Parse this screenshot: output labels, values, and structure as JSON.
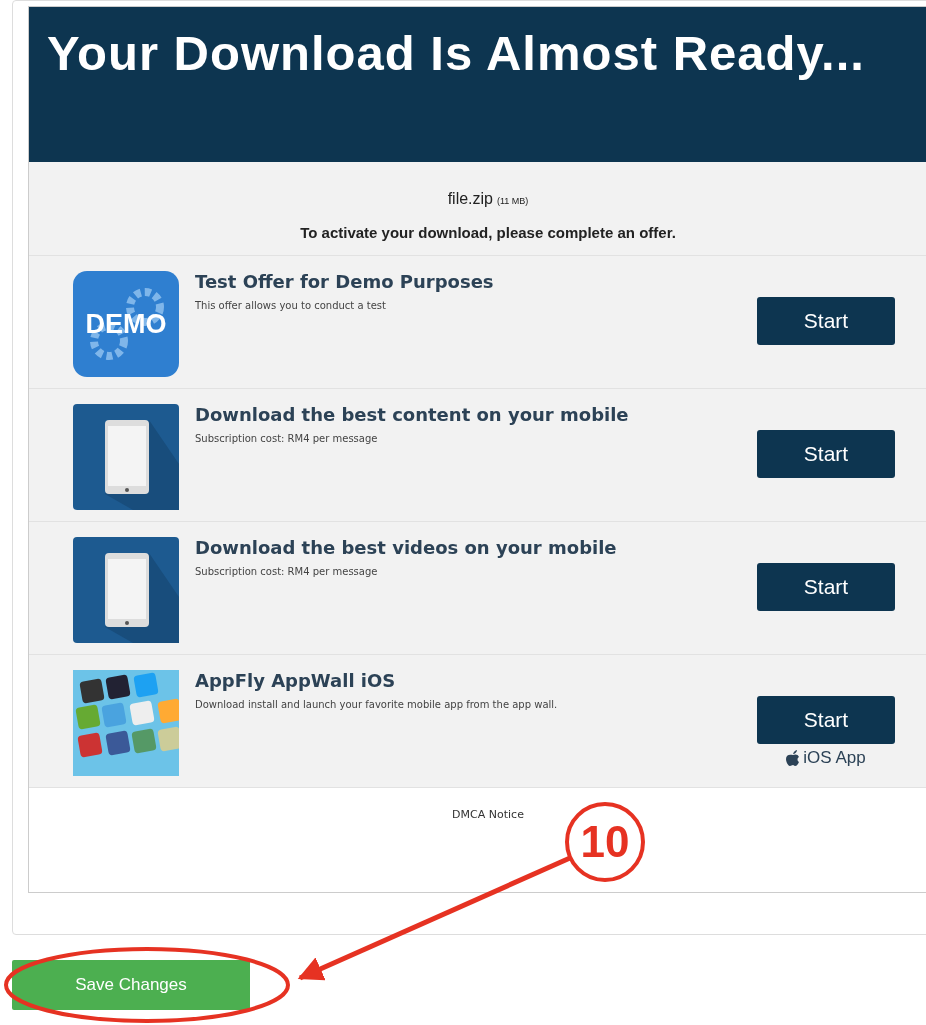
{
  "header": {
    "title": "Your Download Is Almost Ready..."
  },
  "file": {
    "name": "file.zip",
    "size": "(11 MB)"
  },
  "instruction": "To activate your download, please complete an offer.",
  "offers": [
    {
      "kind": "demo",
      "icon_text": "DEMO",
      "title": "Test Offer for Demo Purposes",
      "description": "This offer allows you to conduct a test",
      "button": "Start"
    },
    {
      "kind": "phone",
      "title": "Download the best content on your mobile",
      "description": "Subscription cost: RM4 per message",
      "button": "Start"
    },
    {
      "kind": "phone",
      "title": "Download the best videos on your mobile",
      "description": "Subscription cost: RM4 per message",
      "button": "Start"
    },
    {
      "kind": "appwall",
      "title": "AppFly AppWall iOS",
      "description": "Download install and launch your favorite mobile app from the app wall.",
      "button": "Start",
      "platform": "iOS App"
    }
  ],
  "footer": {
    "link": "DMCA Notice"
  },
  "save_button": "Save Changes",
  "annotation": {
    "step": "10"
  }
}
